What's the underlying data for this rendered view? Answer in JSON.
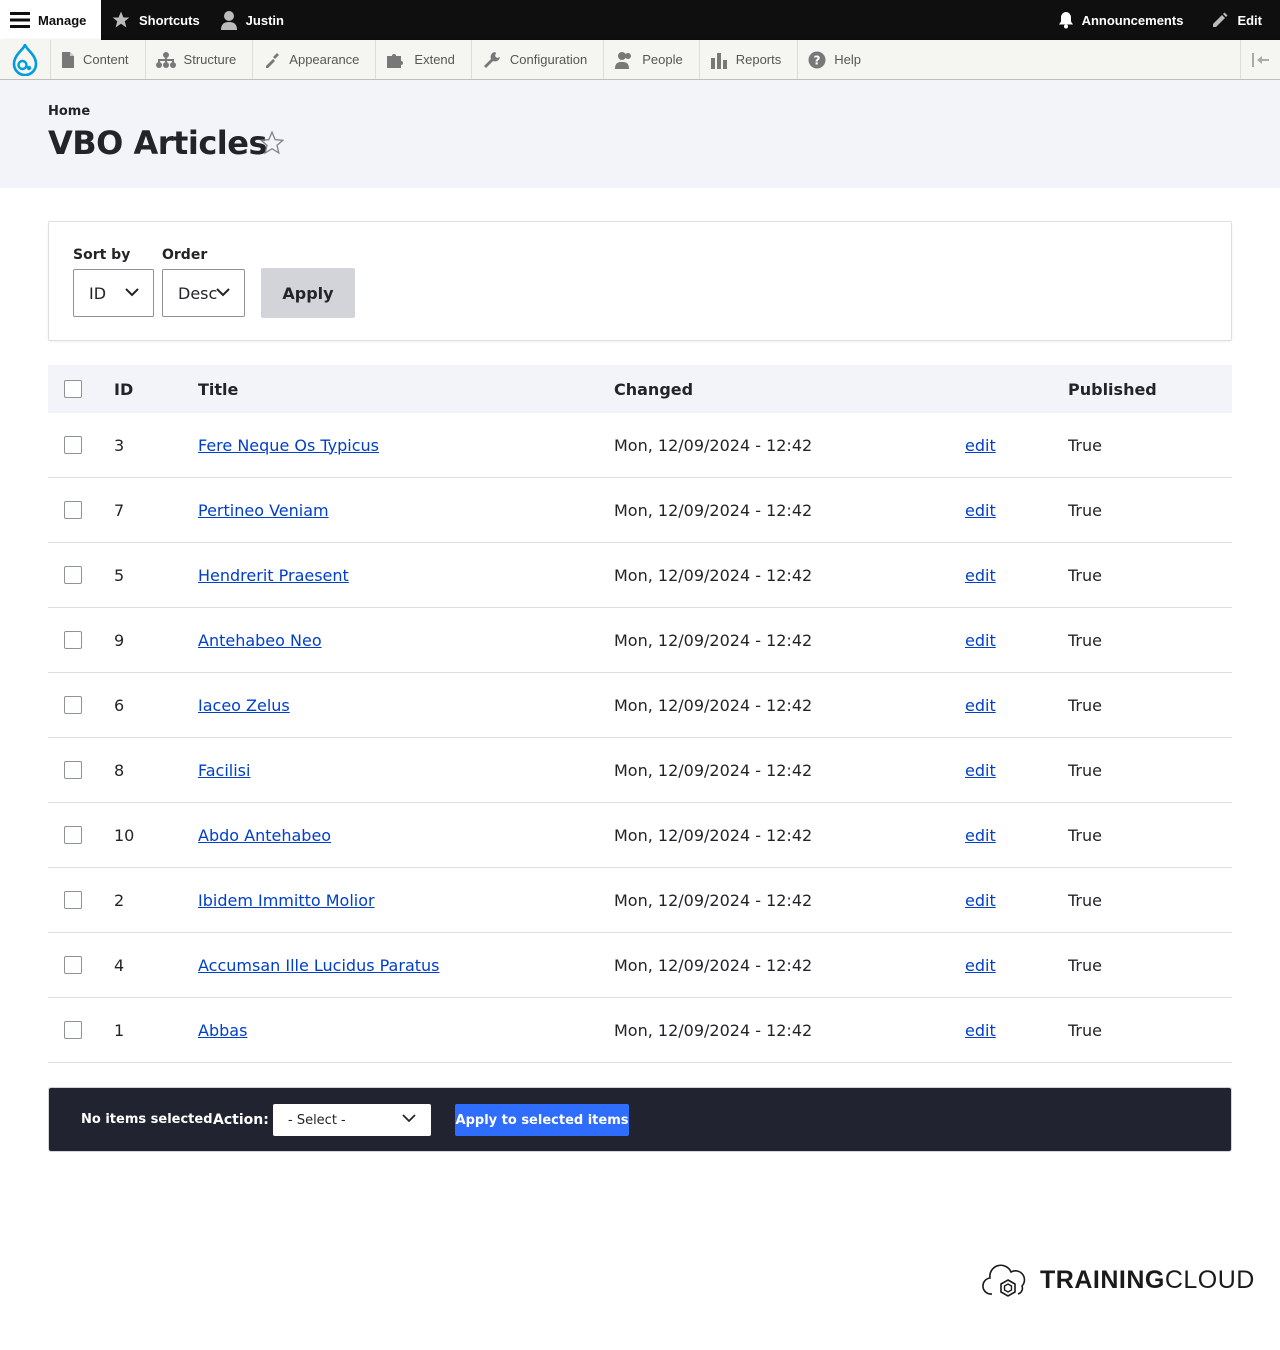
{
  "toolbar": {
    "manage": "Manage",
    "shortcuts": "Shortcuts",
    "user": "Justin",
    "announcements": "Announcements",
    "edit": "Edit"
  },
  "tray": {
    "items": [
      {
        "label": "Content",
        "icon": "document-icon"
      },
      {
        "label": "Structure",
        "icon": "structure-icon"
      },
      {
        "label": "Appearance",
        "icon": "paintbrush-icon"
      },
      {
        "label": "Extend",
        "icon": "puzzle-icon"
      },
      {
        "label": "Configuration",
        "icon": "wrench-icon"
      },
      {
        "label": "People",
        "icon": "people-icon"
      },
      {
        "label": "Reports",
        "icon": "bar-chart-icon"
      },
      {
        "label": "Help",
        "icon": "help-icon"
      }
    ]
  },
  "header": {
    "breadcrumb": "Home",
    "title": "VBO Articles"
  },
  "filters": {
    "sort_label": "Sort by",
    "sort_value": "ID",
    "order_label": "Order",
    "order_value": "Desc",
    "apply_label": "Apply"
  },
  "table": {
    "columns": {
      "id": "ID",
      "title": "Title",
      "changed": "Changed",
      "published": "Published"
    },
    "rows": [
      {
        "id": "3",
        "title": "Fere Neque Os Typicus",
        "changed": "Mon, 12/09/2024 - 12:42",
        "edit": "edit",
        "published": "True"
      },
      {
        "id": "7",
        "title": "Pertineo Veniam",
        "changed": "Mon, 12/09/2024 - 12:42",
        "edit": "edit",
        "published": "True"
      },
      {
        "id": "5",
        "title": "Hendrerit Praesent",
        "changed": "Mon, 12/09/2024 - 12:42",
        "edit": "edit",
        "published": "True"
      },
      {
        "id": "9",
        "title": "Antehabeo Neo",
        "changed": "Mon, 12/09/2024 - 12:42",
        "edit": "edit",
        "published": "True"
      },
      {
        "id": "6",
        "title": "Iaceo Zelus",
        "changed": "Mon, 12/09/2024 - 12:42",
        "edit": "edit",
        "published": "True"
      },
      {
        "id": "8",
        "title": "Facilisi",
        "changed": "Mon, 12/09/2024 - 12:42",
        "edit": "edit",
        "published": "True"
      },
      {
        "id": "10",
        "title": "Abdo Antehabeo",
        "changed": "Mon, 12/09/2024 - 12:42",
        "edit": "edit",
        "published": "True"
      },
      {
        "id": "2",
        "title": "Ibidem Immitto Molior",
        "changed": "Mon, 12/09/2024 - 12:42",
        "edit": "edit",
        "published": "True"
      },
      {
        "id": "4",
        "title": "Accumsan Ille Lucidus Paratus",
        "changed": "Mon, 12/09/2024 - 12:42",
        "edit": "edit",
        "published": "True"
      },
      {
        "id": "1",
        "title": "Abbas",
        "changed": "Mon, 12/09/2024 - 12:42",
        "edit": "edit",
        "published": "True"
      }
    ]
  },
  "bulk": {
    "status": "No items selected",
    "action_label": "Action:",
    "select_value": "- Select -",
    "apply_label": "Apply to selected items"
  },
  "footer": {
    "logo_bold": "TRAINING",
    "logo_light": "CLOUD"
  },
  "colors": {
    "toolbar_bg": "#0f0f0f",
    "link": "#003ecc",
    "primary_button": "#2f6dff",
    "bulk_bar_bg": "#222330",
    "drupal_blue": "#009cde"
  }
}
